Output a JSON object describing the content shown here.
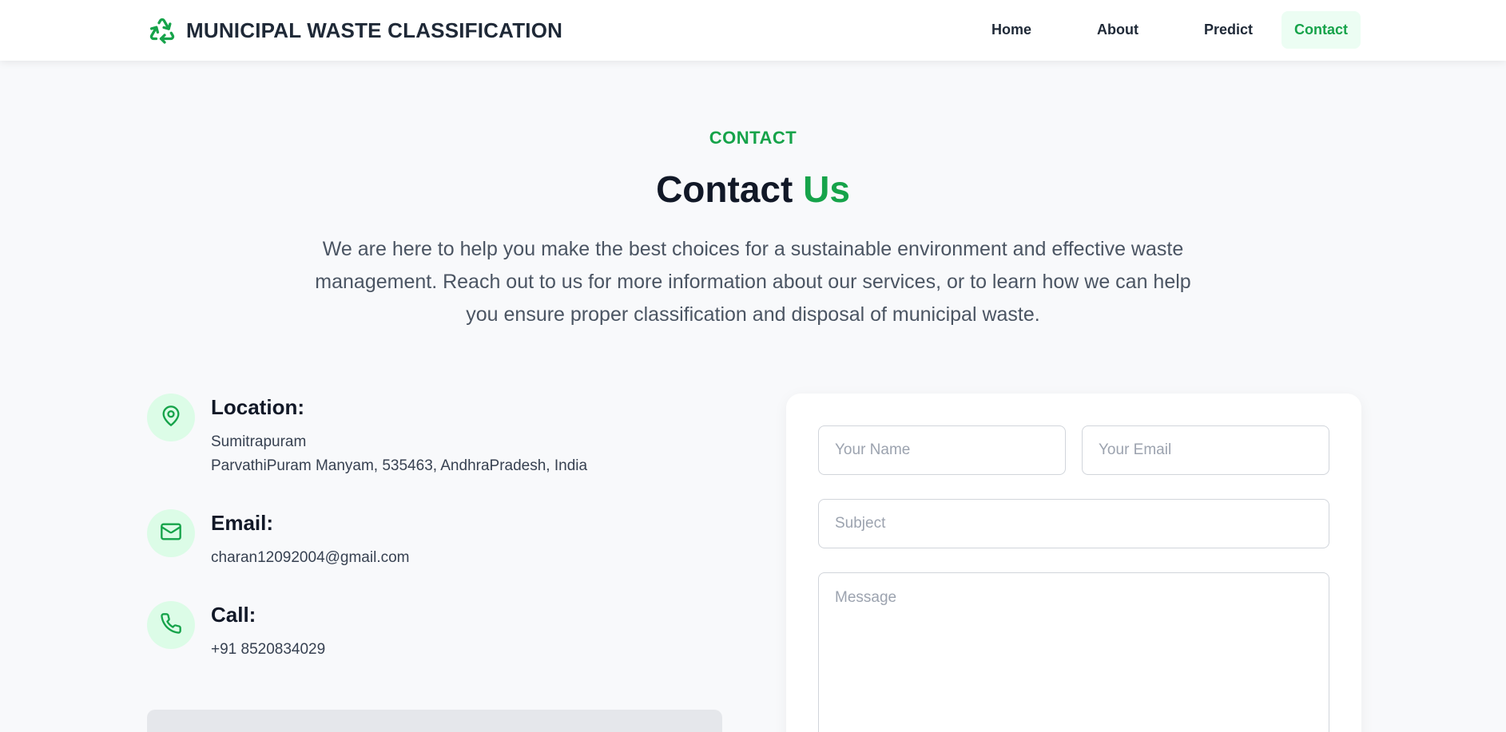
{
  "brand": {
    "title": "MUNICIPAL WASTE CLASSIFICATION",
    "icon": "recycle-icon"
  },
  "nav": {
    "home": "Home",
    "about": "About",
    "predict": "Predict",
    "contact": "Contact",
    "active": "Contact"
  },
  "section": {
    "eyebrow": "CONTACT",
    "title_main": "Contact",
    "title_accent": "Us",
    "lead": "We are here to help you make the best choices for a sustainable environment and effective waste management. Reach out to us for more information about our services, or to learn how we can help you ensure proper classification and disposal of municipal waste."
  },
  "info": {
    "location": {
      "title": "Location:",
      "line1": "Sumitrapuram",
      "line2": "ParvathiPuram Manyam, 535463, AndhraPradesh, India",
      "icon": "map-pin-icon"
    },
    "email": {
      "title": "Email:",
      "value": "charan12092004@gmail.com",
      "icon": "mail-icon"
    },
    "call": {
      "title": "Call:",
      "value": "+91 8520834029",
      "icon": "phone-icon"
    }
  },
  "form": {
    "name_placeholder": "Your Name",
    "email_placeholder": "Your Email",
    "subject_placeholder": "Subject",
    "message_placeholder": "Message"
  },
  "colors": {
    "accent": "#16a34a",
    "accent_light": "#dcfce7",
    "nav_active_bg": "#ecfdf3",
    "text_dark": "#111827",
    "page_bg": "#f8f9fb"
  }
}
